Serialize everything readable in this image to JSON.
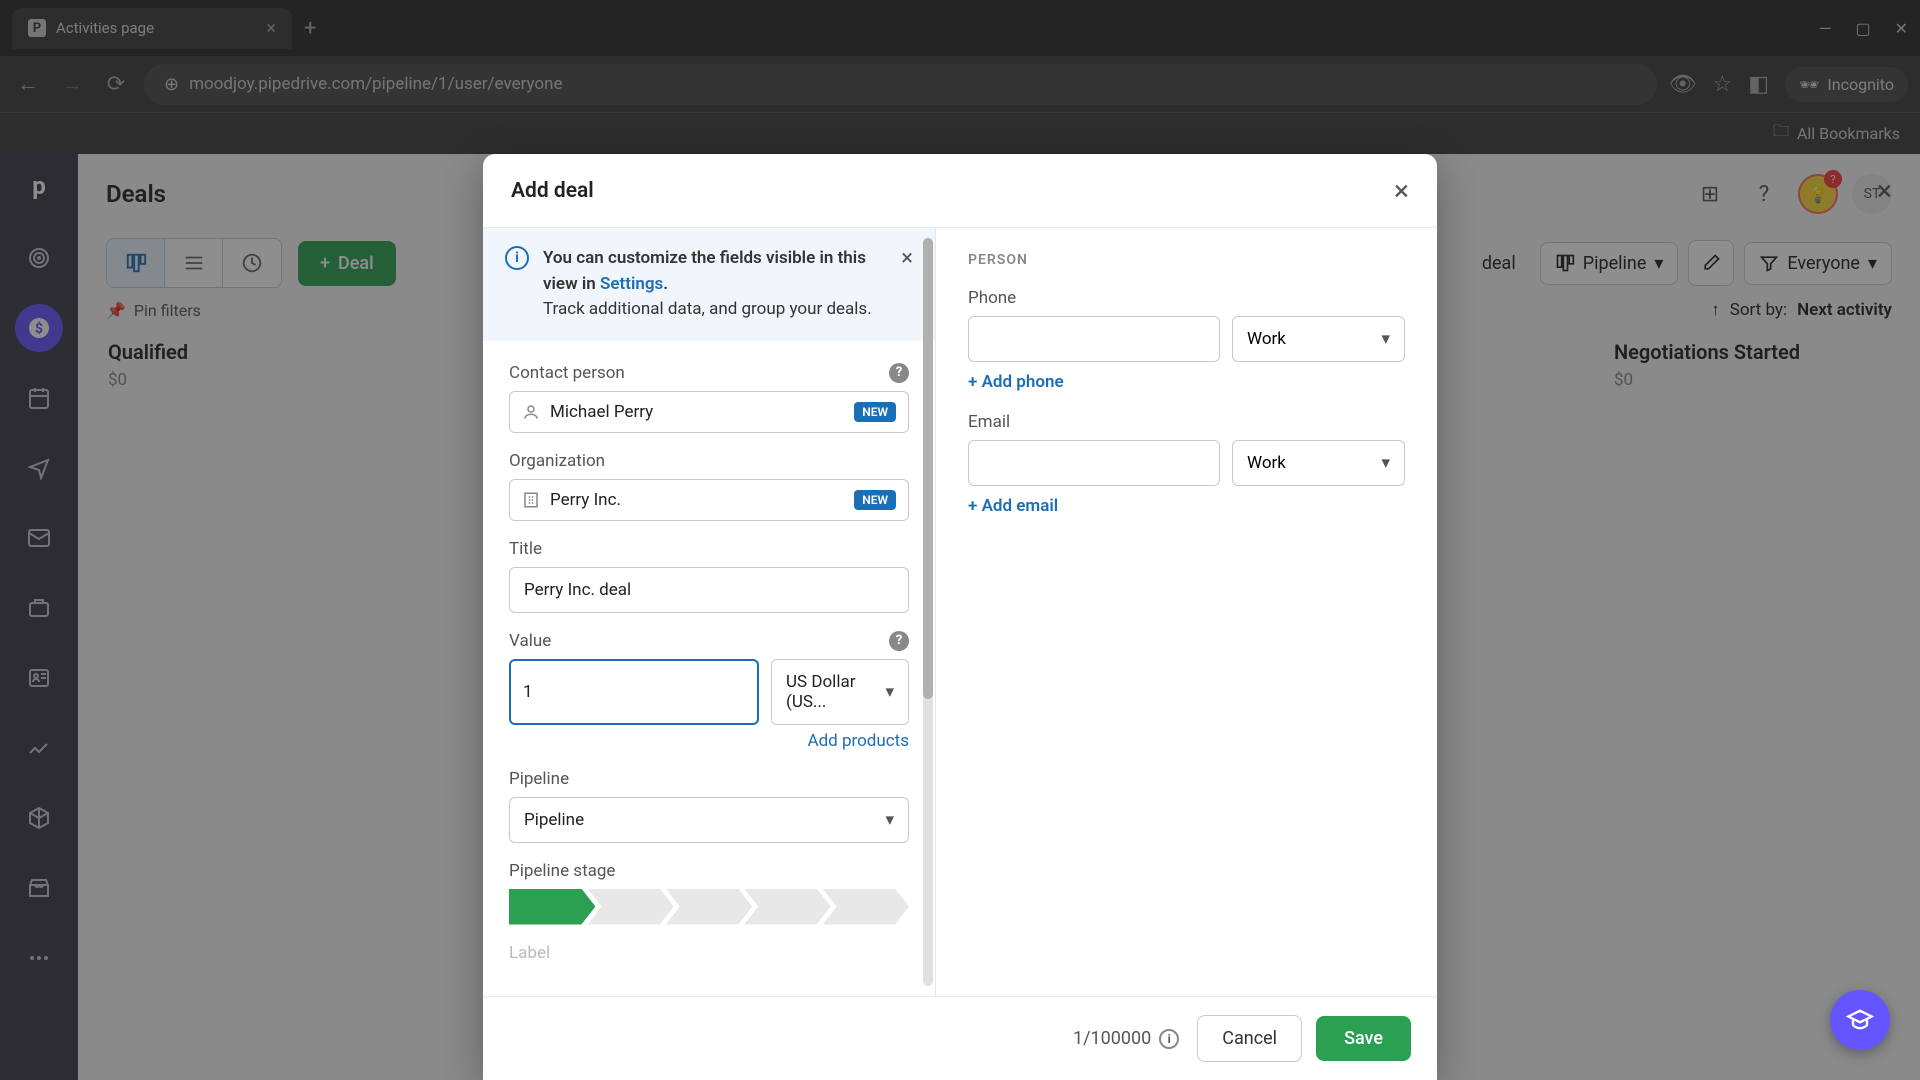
{
  "browser": {
    "tab_title": "Activities page",
    "tab_favicon_letter": "P",
    "url": "moodjoy.pipedrive.com/pipeline/1/user/everyone",
    "incognito_label": "Incognito",
    "bookmarks_label": "All Bookmarks"
  },
  "sidebar": {
    "logo": "p"
  },
  "page": {
    "title": "Deals",
    "user_initials": "ST",
    "badge_count": "?",
    "deal_button": "Deal",
    "pin_filters": "Pin filters",
    "filter_deal": "deal",
    "filter_pipeline": "Pipeline",
    "filter_everyone": "Everyone",
    "sort_label": "Sort by:",
    "sort_value": "Next activity",
    "columns": [
      {
        "title": "Qualified",
        "value": "$0"
      },
      {
        "title": "Negotiations Started",
        "value": "$0"
      }
    ]
  },
  "modal": {
    "title": "Add deal",
    "info_banner": {
      "line1_pre": "You can customize the fields visible in this view in ",
      "link": "Settings",
      "line1_post": ".",
      "line2": "Track additional data, and group your deals."
    },
    "contact_label": "Contact person",
    "contact_value": "Michael Perry",
    "new_badge": "NEW",
    "org_label": "Organization",
    "org_value": "Perry Inc.",
    "title_label": "Title",
    "title_value": "Perry Inc. deal",
    "value_label": "Value",
    "value_amount": "1",
    "currency": "US Dollar (US...",
    "add_products": "Add products",
    "pipeline_label": "Pipeline",
    "pipeline_value": "Pipeline",
    "stage_label": "Pipeline stage",
    "label_label": "Label",
    "person_section": "PERSON",
    "phone_label": "Phone",
    "phone_type": "Work",
    "add_phone": "+ Add phone",
    "email_label": "Email",
    "email_type": "Work",
    "add_email": "+ Add email",
    "char_count": "1/100000",
    "cancel": "Cancel",
    "save": "Save"
  }
}
